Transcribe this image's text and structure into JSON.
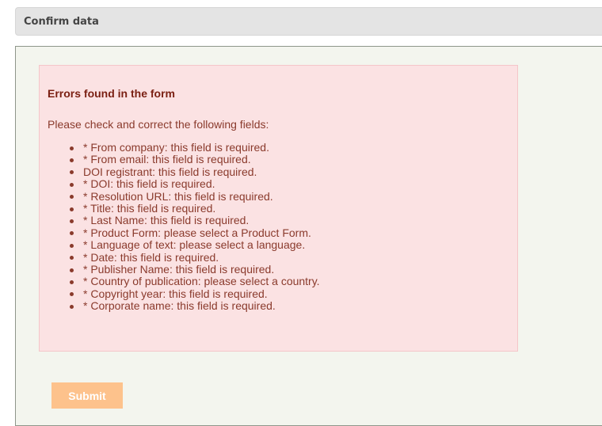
{
  "header": {
    "title": "Confirm data"
  },
  "errors": {
    "heading": "Errors found in the form",
    "intro": "Please check and correct the following fields:",
    "items": [
      "* From company: this field is required.",
      "* From email: this field is required.",
      "DOI registrant: this field is required.",
      "* DOI: this field is required.",
      "* Resolution URL: this field is required.",
      "* Title: this field is required.",
      "* Last Name: this field is required.",
      "* Product Form: please select a Product Form.",
      "* Language of text: please select a language.",
      "* Date: this field is required.",
      "* Publisher Name: this field is required.",
      "* Country of publication: please select a country.",
      "* Copyright year: this field is required.",
      "* Corporate name: this field is required."
    ]
  },
  "form": {
    "submit_label": "Submit"
  },
  "colors": {
    "error_background": "#fbe2e3",
    "error_text": "#8a3a2c",
    "submit_button": "#fdc28c"
  }
}
